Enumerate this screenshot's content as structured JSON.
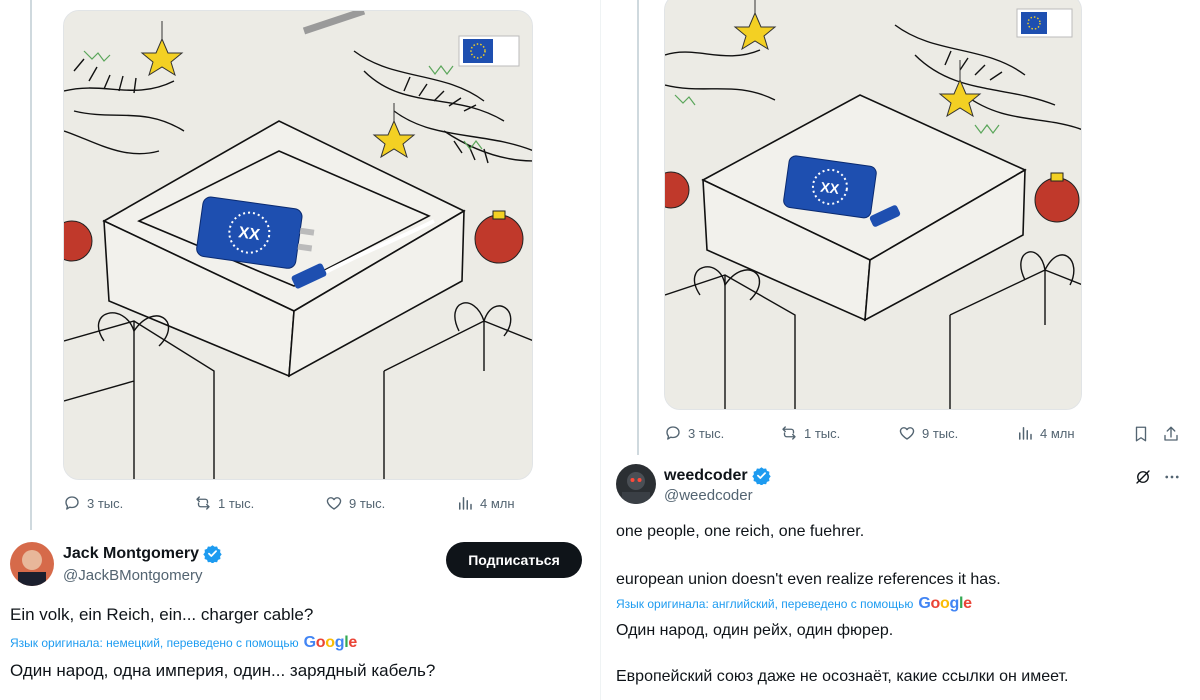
{
  "left_post": {
    "stats": {
      "replies": "3 тыс.",
      "reposts": "1 тыс.",
      "likes": "9 тыс.",
      "views": "4 млн"
    },
    "author": {
      "name": "Jack Montgomery",
      "handle": "@JackBMontgomery"
    },
    "follow_label": "Подписаться",
    "text": "Ein volk, ein Reich, ein... charger cable?",
    "translation_note": "Язык оригинала: немецкий, переведено с помощью",
    "translation": "Один народ, одна империя, один... зарядный кабель?"
  },
  "right_post": {
    "stats": {
      "replies": "3 тыс.",
      "reposts": "1 тыс.",
      "likes": "9 тыс.",
      "views": "4 млн"
    },
    "author": {
      "name": "weedcoder",
      "handle": "@weedcoder"
    },
    "text_line1": "one people, one reich, one fuehrer.",
    "text_line2": "european union doesn't even realize references it has.",
    "translation_note": "Язык оригинала: английский, переведено с помощью",
    "translation_line1": "Один народ, один рейх, один фюрер.",
    "translation_line2": "Европейский союз даже не осознаёт, какие ссылки он имеет."
  },
  "google_logo": "Google",
  "icons": [
    "reply-icon",
    "repost-icon",
    "like-icon",
    "views-icon",
    "bookmark-icon",
    "share-icon",
    "verified-icon",
    "grok-icon",
    "more-icon"
  ],
  "colors": {
    "accent": "#1d9bf0",
    "text": "#0f1419",
    "muted": "#536471",
    "button": "#0f1419",
    "eu_blue": "#1e4fb0"
  }
}
